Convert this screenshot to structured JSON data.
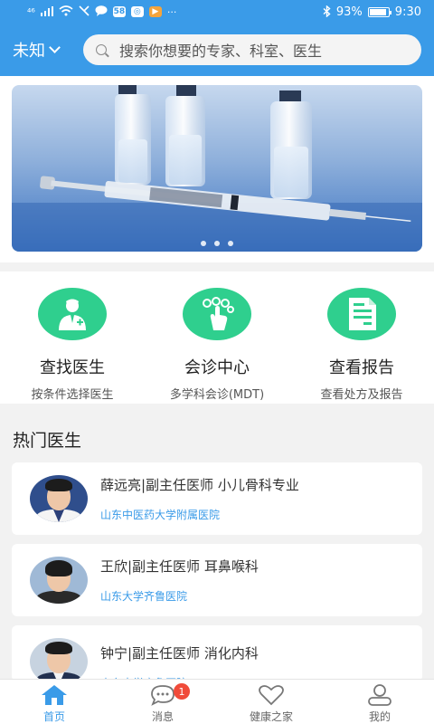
{
  "status_bar": {
    "signal_text": "⁴⁶",
    "battery_text": "93%",
    "time": "9:30",
    "battery_level": 0.93
  },
  "header": {
    "city": "未知",
    "search_placeholder": "搜索你想要的专家、科室、医生"
  },
  "banner": {
    "page_count": 3
  },
  "actions": [
    {
      "title": "查找医生",
      "subtitle": "按条件选择医生",
      "icon": "doctor-icon"
    },
    {
      "title": "会诊中心",
      "subtitle": "多学科会诊(MDT)",
      "icon": "consultation-icon"
    },
    {
      "title": "查看报告",
      "subtitle": "查看处方及报告",
      "icon": "report-icon"
    }
  ],
  "hot_doctors": {
    "title": "热门医生",
    "items": [
      {
        "name": "薛远亮|副主任医师 小儿骨科专业",
        "hospital": "山东中医药大学附属医院"
      },
      {
        "name": "王欣|副主任医师 耳鼻喉科",
        "hospital": "山东大学齐鲁医院"
      },
      {
        "name": "钟宁|副主任医师 消化内科",
        "hospital": "山东大学齐鲁医院"
      }
    ]
  },
  "tabs": [
    {
      "label": "首页",
      "icon": "home-icon",
      "active": true
    },
    {
      "label": "消息",
      "icon": "message-icon",
      "badge": "1"
    },
    {
      "label": "健康之家",
      "icon": "heart-icon"
    },
    {
      "label": "我的",
      "icon": "user-icon"
    }
  ],
  "colors": {
    "primary": "#3a9be8",
    "accent_green": "#2fcf8e",
    "badge_red": "#f04b3a"
  }
}
